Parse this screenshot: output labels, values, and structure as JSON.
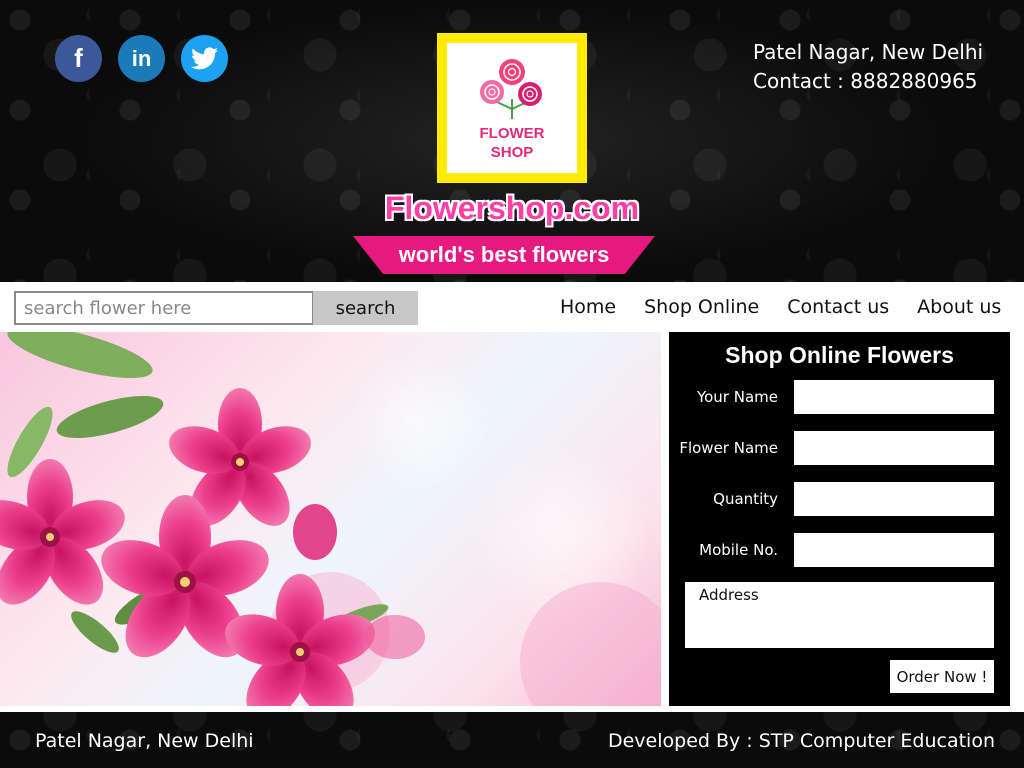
{
  "header": {
    "social": [
      {
        "name": "facebook",
        "glyph": "f",
        "color": "#3b5998"
      },
      {
        "name": "linkedin",
        "glyph": "in",
        "color": "#1a7bb8"
      },
      {
        "name": "twitter",
        "glyph": "",
        "color": "#1da1f2"
      }
    ],
    "address": "Patel Nagar, New Delhi",
    "contact": "Contact  : 8882880965",
    "logo_line1": "FLOWER",
    "logo_line2": "SHOP",
    "site_title": "Flowershop.com",
    "tagline": "world's best flowers"
  },
  "navbar": {
    "search_placeholder": "search flower here",
    "search_button": "search",
    "links": [
      "Home",
      "Shop Online",
      "Contact us",
      "About us"
    ]
  },
  "order_form": {
    "title": "Shop Online Flowers",
    "fields": [
      {
        "label": "Your Name",
        "value": ""
      },
      {
        "label": "Flower Name",
        "value": ""
      },
      {
        "label": "Quantity",
        "value": ""
      },
      {
        "label": "Mobile No.",
        "value": ""
      }
    ],
    "address_placeholder": "Address",
    "submit": "Order Now !"
  },
  "footer": {
    "left": "Patel Nagar, New Delhi",
    "right": "Developed By :  STP Computer Education"
  },
  "colors": {
    "accent_pink": "#e6197f",
    "logo_border": "#ffeb00",
    "title_pink": "#ff3ea5"
  }
}
